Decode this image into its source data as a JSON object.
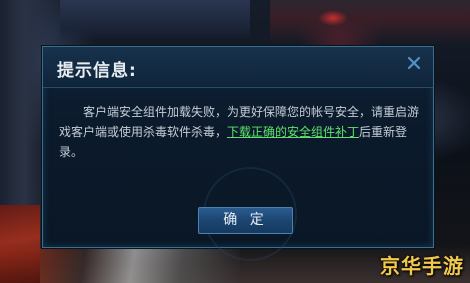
{
  "dialog": {
    "title": "提示信息:",
    "message_before_link": "客户端安全组件加载失败，为更好保障您的帐号安全，请重启游戏客户端或使用杀毒软件杀毒，",
    "link_text": "下载正确的安全组件补丁",
    "message_after_link": "后重新登录。",
    "ok_label": "确 定",
    "link_color": "#5de36a"
  },
  "watermark": {
    "text": "京华手游"
  },
  "icons": {
    "close": "close-icon"
  }
}
